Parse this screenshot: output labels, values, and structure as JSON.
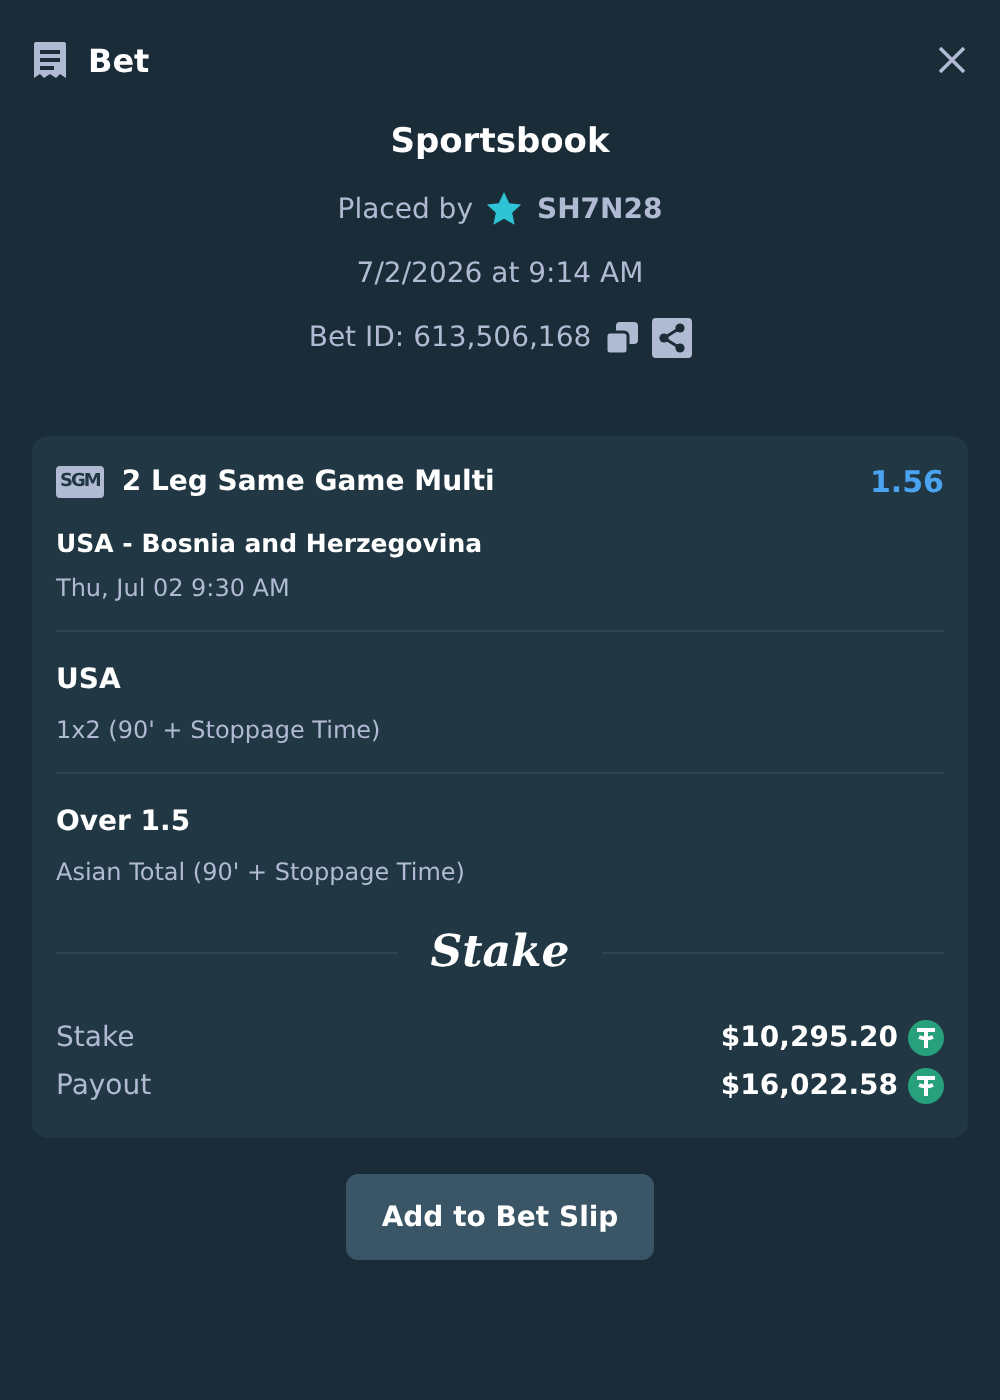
{
  "header": {
    "title": "Bet"
  },
  "summary": {
    "title": "Sportsbook",
    "placed_by_label": "Placed by",
    "user": "SH7N28",
    "date": "7/2/2026 at 9:14 AM",
    "bet_id": "Bet ID: 613,506,168"
  },
  "bet": {
    "badge": "SGM",
    "title": "2 Leg Same Game Multi",
    "odds": "1.56",
    "event": "USA - Bosnia and Herzegovina",
    "event_time": "Thu, Jul 02 9:30 AM",
    "legs": [
      {
        "selection": "USA",
        "market": "1x2 (90' + Stoppage Time)"
      },
      {
        "selection": "Over 1.5",
        "market": "Asian Total (90' + Stoppage Time)"
      }
    ],
    "logo": "Stake",
    "amounts": [
      {
        "label": "Stake",
        "value": "$10,295.20"
      },
      {
        "label": "Payout",
        "value": "$16,022.58"
      }
    ]
  },
  "button": "Add to Bet Slip"
}
